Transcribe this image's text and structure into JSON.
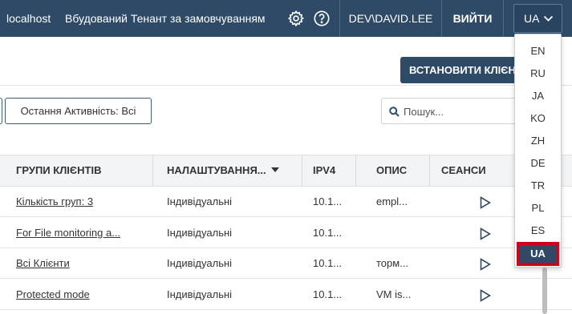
{
  "header": {
    "host": "localhost",
    "tenant": "Вбудований Тенант за замовчуванням",
    "user": "DEV\\DAVID.LEE",
    "logout": "ВИЙТИ",
    "language": "UA"
  },
  "toolbar": {
    "install_button": "ВСТАНОВИТИ КЛІЄНТ",
    "activity_filter": "Остання Активність: Всі",
    "search_placeholder": "Пошук..."
  },
  "table": {
    "columns": [
      "ГРУПИ КЛІЄНТІВ",
      "НАЛАШТУВАННЯ...",
      "IPV4",
      "ОПИС",
      "СЕАНСИ"
    ],
    "rows": [
      {
        "group": "Кількість груп: 3",
        "settings": "Індивідуальні",
        "ipv4": "10.1...",
        "description": "empl..."
      },
      {
        "group": "For File monitoring a...",
        "settings": "Індивідуальні",
        "ipv4": "10.1...",
        "description": ""
      },
      {
        "group": "Всі Клієнти",
        "settings": "Індивідуальні",
        "ipv4": "10.1...",
        "description": "торм..."
      },
      {
        "group": "Protected mode",
        "settings": "Індивідуальні",
        "ipv4": "10.1...",
        "description": "VM is..."
      }
    ]
  },
  "language_menu": {
    "options": [
      "EN",
      "RU",
      "JA",
      "KO",
      "ZH",
      "DE",
      "TR",
      "PL",
      "ES",
      "UA"
    ],
    "selected": "UA"
  },
  "colors": {
    "primary": "#2e4a66",
    "highlight": "#d0021b"
  }
}
